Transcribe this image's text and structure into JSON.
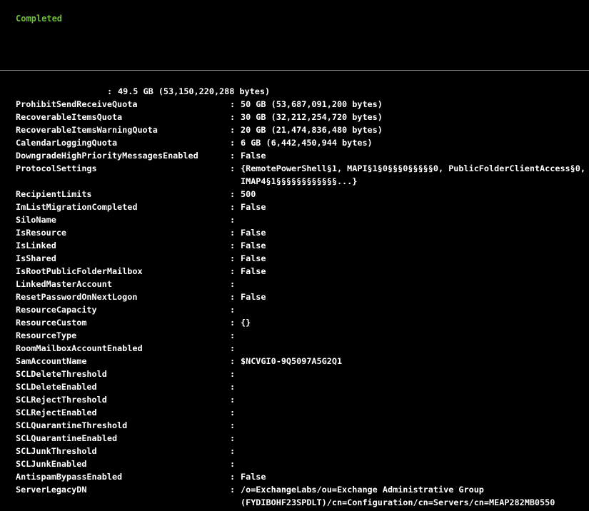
{
  "status": {
    "text": "Completed",
    "color": "#6fbd3a"
  },
  "output": {
    "separator": ":",
    "partial_line": {
      "value": "49.5 GB (53,150,220,288 bytes)"
    },
    "rows": [
      {
        "key": "ProhibitSendReceiveQuota",
        "value": "50 GB (53,687,091,200 bytes)"
      },
      {
        "key": "RecoverableItemsQuota",
        "value": "30 GB (32,212,254,720 bytes)"
      },
      {
        "key": "RecoverableItemsWarningQuota",
        "value": "20 GB (21,474,836,480 bytes)"
      },
      {
        "key": "CalendarLoggingQuota",
        "value": "6 GB (6,442,450,944 bytes)"
      },
      {
        "key": "DowngradeHighPriorityMessagesEnabled",
        "value": "False"
      },
      {
        "key": "ProtocolSettings",
        "value": "{RemotePowerShell§1, MAPI§1§0§§§0§§§§§0, PublicFolderClientAccess§0,\nIMAP4§1§§§§§§§§§§§§...}",
        "tall": true
      },
      {
        "key": "RecipientLimits",
        "value": "500"
      },
      {
        "key": "ImListMigrationCompleted",
        "value": "False"
      },
      {
        "key": "SiloName",
        "value": ""
      },
      {
        "key": "IsResource",
        "value": "False"
      },
      {
        "key": "IsLinked",
        "value": "False"
      },
      {
        "key": "IsShared",
        "value": "False"
      },
      {
        "key": "IsRootPublicFolderMailbox",
        "value": "False"
      },
      {
        "key": "LinkedMasterAccount",
        "value": ""
      },
      {
        "key": "ResetPasswordOnNextLogon",
        "value": "False"
      },
      {
        "key": "ResourceCapacity",
        "value": ""
      },
      {
        "key": "ResourceCustom",
        "value": "{}"
      },
      {
        "key": "ResourceType",
        "value": ""
      },
      {
        "key": "RoomMailboxAccountEnabled",
        "value": ""
      },
      {
        "key": "SamAccountName",
        "value": "$NCVGI0-9Q5097A5G2Q1"
      },
      {
        "key": "SCLDeleteThreshold",
        "value": ""
      },
      {
        "key": "SCLDeleteEnabled",
        "value": ""
      },
      {
        "key": "SCLRejectThreshold",
        "value": ""
      },
      {
        "key": "SCLRejectEnabled",
        "value": ""
      },
      {
        "key": "SCLQuarantineThreshold",
        "value": ""
      },
      {
        "key": "SCLQuarantineEnabled",
        "value": ""
      },
      {
        "key": "SCLJunkThreshold",
        "value": ""
      },
      {
        "key": "SCLJunkEnabled",
        "value": ""
      },
      {
        "key": "AntispamBypassEnabled",
        "value": "False"
      },
      {
        "key": "ServerLegacyDN",
        "value": "/o=ExchangeLabs/ou=Exchange Administrative Group\n(FYDIBOHF23SPDLT)/cn=Configuration/cn=Servers/cn=MEAP282MB0550",
        "tall": true
      }
    ]
  }
}
